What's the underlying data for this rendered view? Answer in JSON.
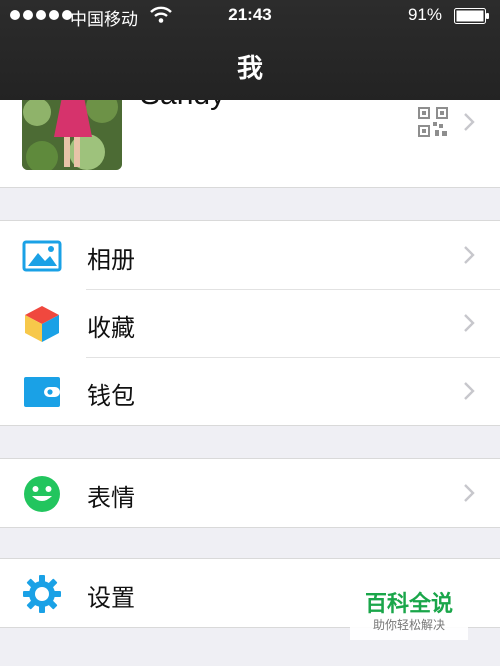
{
  "status_bar": {
    "carrier": "中国移动",
    "time": "21:43",
    "battery": "91%"
  },
  "nav": {
    "title": "我"
  },
  "profile": {
    "name": "Sandy"
  },
  "groups": [
    {
      "items": [
        {
          "label": "相册",
          "icon": "photo-album-icon"
        },
        {
          "label": "收藏",
          "icon": "favorites-cube-icon"
        },
        {
          "label": "钱包",
          "icon": "wallet-icon"
        }
      ]
    },
    {
      "items": [
        {
          "label": "表情",
          "icon": "sticker-smile-icon"
        }
      ]
    },
    {
      "items": [
        {
          "label": "设置",
          "icon": "settings-gear-icon"
        }
      ]
    }
  ],
  "watermark": {
    "main": "百科全说",
    "sub": "助你轻松解决"
  },
  "colors": {
    "nav_bg": "#262626",
    "page_bg": "#efeff4",
    "accent_blue": "#1aa1e6",
    "accent_green": "#22c55e",
    "watermark_green": "#1aa64a"
  }
}
